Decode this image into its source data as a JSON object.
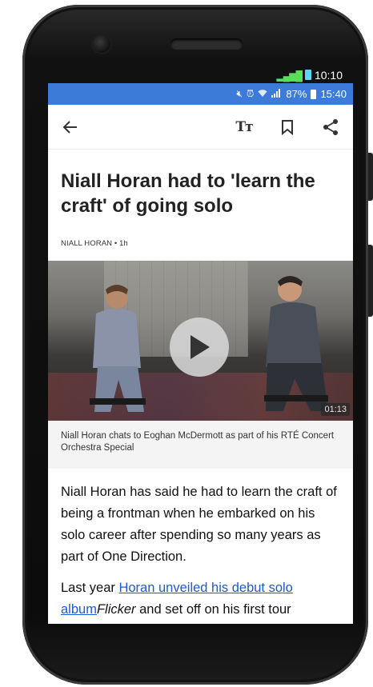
{
  "device_status": {
    "time": "10:10"
  },
  "status_bar": {
    "icons": [
      "mute-icon",
      "alarm-icon",
      "wifi-icon",
      "signal-icon"
    ],
    "battery": "87%",
    "time": "15:40"
  },
  "toolbar": {
    "back_icon": "back-arrow-icon",
    "text_size_label": "Tт",
    "bookmark_icon": "bookmark-icon",
    "share_icon": "share-icon"
  },
  "article": {
    "headline": "Niall Horan had to 'learn the craft' of going solo",
    "byline": "NIALL HORAN • 1h",
    "video": {
      "duration": "01:13"
    },
    "caption": "Niall Horan chats to Eoghan McDermott as part of his RTÉ Concert Orchestra Special",
    "paragraph1": "Niall Horan has said he had to learn the craft of being a frontman when he embarked on his solo career after spending so many years as part of One Direction.",
    "paragraph2_start": "Last year ",
    "paragraph2_link": "Horan unveiled his debut solo album",
    "paragraph2_em": "Flicker",
    "paragraph2_end": " and set off on his first tour"
  },
  "colors": {
    "status_bar": "#3d7bd8",
    "link": "#1a5bd6",
    "caption_bg": "#f4f4f4"
  }
}
